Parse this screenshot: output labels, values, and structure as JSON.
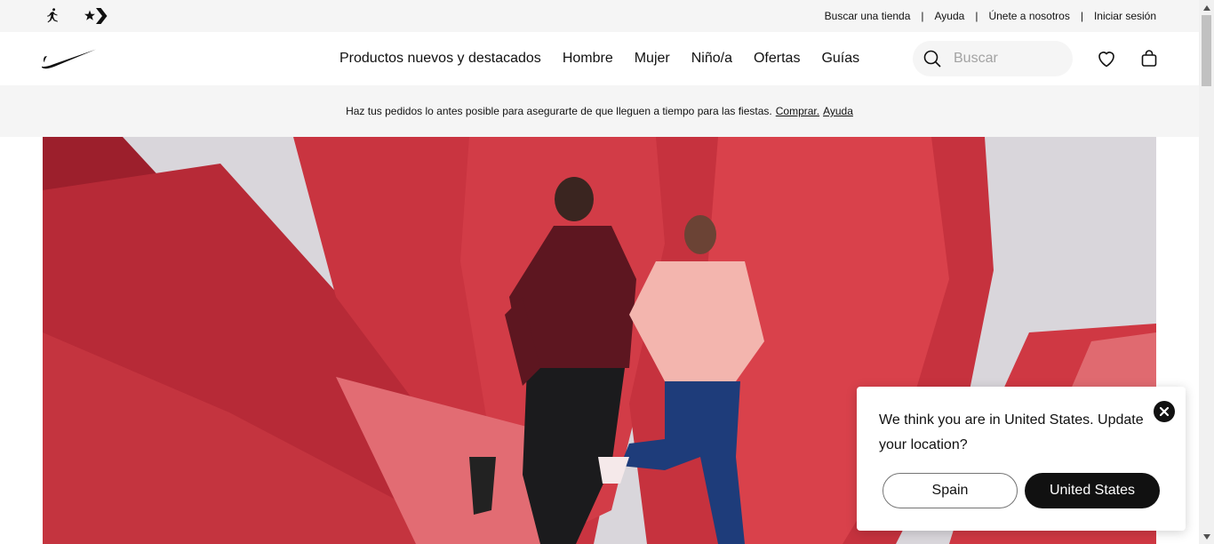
{
  "utility_bar": {
    "links": [
      "Buscar una tienda",
      "Ayuda",
      "Únete a nosotros",
      "Iniciar sesión"
    ],
    "separator": "|",
    "brand_icons": [
      "jordan-jumpman-icon",
      "converse-star-chevron-icon"
    ]
  },
  "header": {
    "logo": "nike-swoosh-icon",
    "nav": [
      "Productos nuevos y destacados",
      "Hombre",
      "Mujer",
      "Niño/a",
      "Ofertas",
      "Guías"
    ],
    "search": {
      "placeholder": "Buscar",
      "value": "",
      "icon": "search-icon"
    },
    "icons": [
      "heart-icon",
      "bag-icon"
    ]
  },
  "promo": {
    "text": "Haz tus pedidos lo antes posible para asegurarte de que lleguen a tiempo para las fiestas.",
    "link_shop": "Comprar.",
    "link_help": "Ayuda"
  },
  "hero": {
    "description_icon": "hero-image"
  },
  "location_popup": {
    "message": "We think you are in United States. Update your location?",
    "secondary_button": "Spain",
    "primary_button": "United States",
    "close_icon": "close-icon"
  },
  "colors": {
    "text": "#111111",
    "utility_bg": "#f5f5f5",
    "hero_red": "#c8323e",
    "hero_dark_red": "#8e1c28",
    "hero_bg": "#d7d4d9"
  }
}
